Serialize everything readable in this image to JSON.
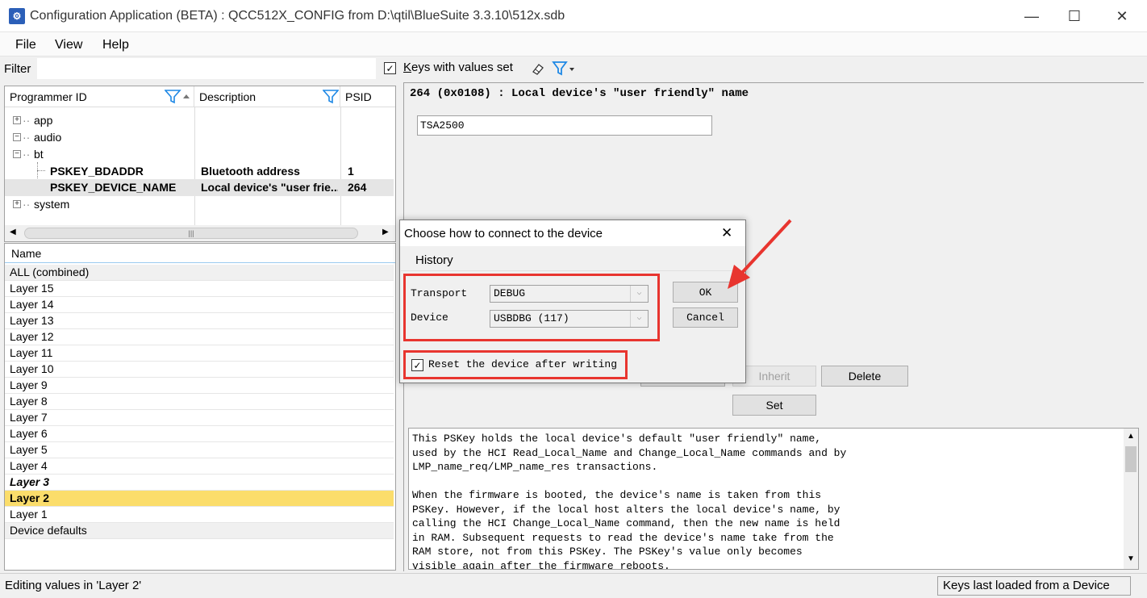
{
  "window": {
    "title": "Configuration Application (BETA) : QCC512X_CONFIG from D:\\qtil\\BlueSuite 3.3.10\\512x.sdb",
    "minimize": "—",
    "maximize": "☐",
    "close": "✕"
  },
  "menu": [
    "File",
    "View",
    "Help"
  ],
  "filter": {
    "label": "Filter",
    "value": "",
    "keys_with_values_label": "Keys with values set",
    "keys_with_values_checked": true
  },
  "tree": {
    "columns": [
      "Programmer ID",
      "Description",
      "PSID"
    ],
    "rows": [
      {
        "id": "app",
        "expander": "+",
        "description": "",
        "psid": "",
        "level": 0,
        "bold": false
      },
      {
        "id": "audio",
        "expander": "−",
        "description": "",
        "psid": "",
        "level": 0,
        "bold": false
      },
      {
        "id": "bt",
        "expander": "−",
        "description": "",
        "psid": "",
        "level": 0,
        "bold": false
      },
      {
        "id": "PSKEY_BDADDR",
        "expander": "",
        "description": "Bluetooth address",
        "psid": "1",
        "level": 1,
        "bold": true
      },
      {
        "id": "PSKEY_DEVICE_NAME",
        "expander": "",
        "description": "Local device's \"user frie...",
        "psid": "264",
        "level": 1,
        "bold": true,
        "selected": true
      },
      {
        "id": "system",
        "expander": "+",
        "description": "",
        "psid": "",
        "level": 0,
        "bold": false
      }
    ]
  },
  "layers": {
    "header": "Name",
    "items": [
      {
        "label": "ALL (combined)",
        "style": "gray"
      },
      {
        "label": "Layer 15",
        "style": "normal"
      },
      {
        "label": "Layer 14",
        "style": "normal"
      },
      {
        "label": "Layer 13",
        "style": "normal"
      },
      {
        "label": "Layer 12",
        "style": "normal"
      },
      {
        "label": "Layer 11",
        "style": "normal"
      },
      {
        "label": "Layer 10",
        "style": "normal"
      },
      {
        "label": "Layer 9",
        "style": "normal"
      },
      {
        "label": "Layer 8",
        "style": "normal"
      },
      {
        "label": "Layer 7",
        "style": "normal"
      },
      {
        "label": "Layer 6",
        "style": "normal"
      },
      {
        "label": "Layer 5",
        "style": "normal"
      },
      {
        "label": "Layer 4",
        "style": "normal"
      },
      {
        "label": "Layer 3",
        "style": "bold-italic"
      },
      {
        "label": "Layer 2",
        "style": "selected"
      },
      {
        "label": "Layer 1",
        "style": "normal"
      },
      {
        "label": "Device defaults",
        "style": "gray"
      }
    ]
  },
  "key_detail": {
    "header": "264 (0x0108) : Local device's \"user friendly\" name",
    "value": "TSA2500",
    "buttons": {
      "inherit": "Inherit",
      "delete": "Delete",
      "set": "Set"
    },
    "description": "This PSKey holds the local device's default \"user friendly\" name,\nused by the HCI Read_Local_Name and Change_Local_Name commands and by\nLMP_name_req/LMP_name_res transactions.\n\nWhen the firmware is booted, the device's name is taken from this\nPSKey. However, if the local host alters the local device's name, by\ncalling the HCI Change_Local_Name command, then the new name is held\nin RAM. Subsequent requests to read the device's name take from the\nRAM store, not from this PSKey. The PSKey's value only becomes\nvisible again after the firmware reboots."
  },
  "dialog": {
    "title": "Choose how to connect to the device",
    "tab": "History",
    "transport_label": "Transport",
    "transport_value": "DEBUG",
    "device_label": "Device",
    "device_value": "USBDBG (117)",
    "reset_label": "Reset the device after writing",
    "reset_checked": true,
    "ok": "OK",
    "cancel": "Cancel"
  },
  "status": {
    "left": "Editing values in 'Layer 2'",
    "right": "Keys last loaded from a Device"
  },
  "colors": {
    "selection_yellow": "#fbdd6b",
    "annotation_red": "#e8352f",
    "filter_icon_blue": "#1e88e5"
  }
}
